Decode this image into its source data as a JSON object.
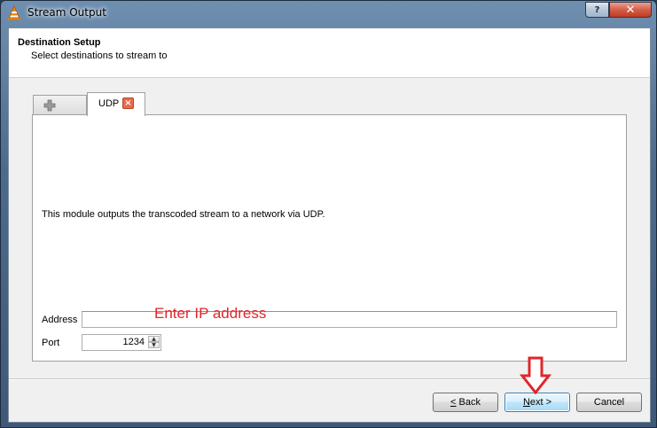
{
  "window": {
    "title": "Stream Output",
    "help_label": "?",
    "close_label": "✕"
  },
  "header": {
    "title": "Destination Setup",
    "subtitle": "Select destinations to stream to"
  },
  "tabs": {
    "add_icon": "plus-icon",
    "active_label": "UDP",
    "close_icon": "close-icon"
  },
  "panel": {
    "description": "This module outputs the transcoded stream to a network via UDP.",
    "address_label": "Address",
    "address_value": "",
    "address_hint": "Enter IP address",
    "port_label": "Port",
    "port_value": "1234"
  },
  "buttons": {
    "back_mnemonic": "<",
    "back_rest": " Back",
    "next_mnemonic": "N",
    "next_rest": "ext >",
    "cancel": "Cancel"
  },
  "colors": {
    "annotation_red": "#e0262b",
    "tab_close": "#e86a4c"
  }
}
